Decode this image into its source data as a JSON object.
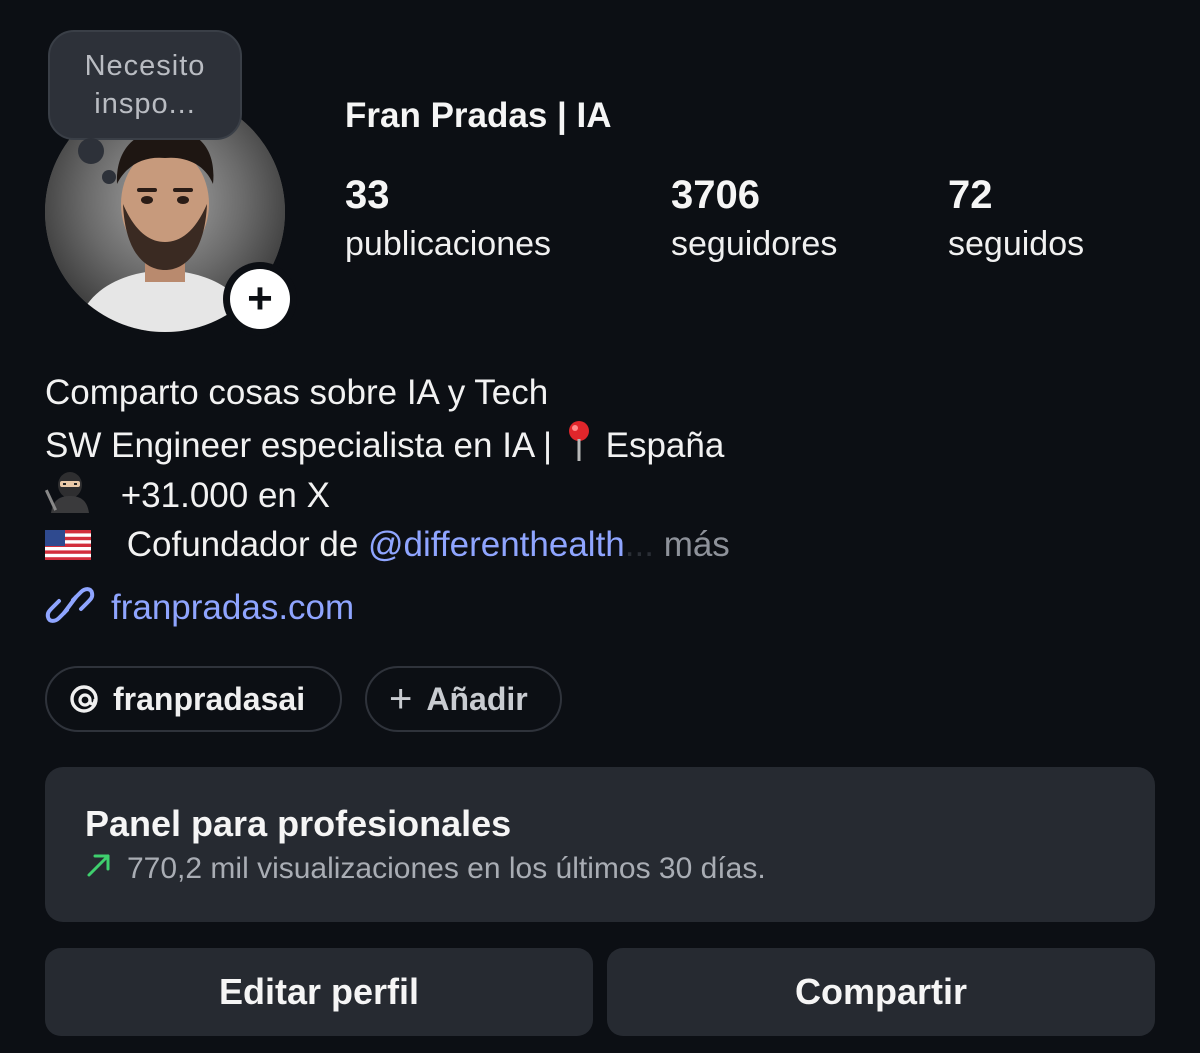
{
  "profile": {
    "username": "Fran Pradas | IA",
    "note": "Necesito inspo..."
  },
  "stats": [
    {
      "value": "33",
      "label": "publicaciones"
    },
    {
      "value": "3706",
      "label": "seguidores"
    },
    {
      "value": "72",
      "label": "seguidos"
    }
  ],
  "bio": {
    "line1": "Comparto cosas sobre IA y Tech",
    "line2_text": "SW Engineer especialista en IA |",
    "line2_place": "España",
    "line3": "+31.000 en X",
    "line4_text": "Cofundador de ",
    "line4_mention": "@differenthealth",
    "line4_ellipsis": "...",
    "more": "más"
  },
  "link": {
    "text": "franpradas.com",
    "icon": "link-icon"
  },
  "pills": {
    "threads": "franpradasai",
    "add": "Añadir"
  },
  "dashboard": {
    "title": "Panel para profesionales",
    "subtitle": "770,2 mil visualizaciones en los últimos 30 días."
  },
  "buttons": {
    "edit": "Editar perfil",
    "share": "Compartir"
  },
  "colors": {
    "background": "#0c0f14",
    "link": "#8fa5ff",
    "trend": "#3fcf6e",
    "card": "#262a31"
  }
}
